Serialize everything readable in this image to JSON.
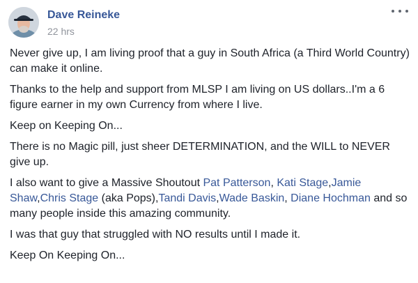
{
  "post": {
    "author": "Dave Reineke",
    "timestamp": "22 hrs",
    "more_icon": "ellipsis-icon",
    "paragraphs": {
      "p1": "Never give up, I am living proof that a guy in South Africa (a Third World Country) can make it online.",
      "p2": "Thanks to the help and support from MLSP I am living on US dollars..I'm a 6 figure earner in my own Currency from where I live.",
      "p3": "Keep on Keeping On...",
      "p4": "There is no Magic pill, just sheer DETERMINATION, and the WILL to NEVER give up.",
      "p5_start": "I also want to give a Massive Shoutout ",
      "p5_comma": ", ",
      "p5_c2": ",",
      "p5_c3": ",",
      "p5_pops": " (aka Pops),",
      "p5_c4": ",",
      "p5_c5": ", ",
      "p5_end": " and so many people inside this amazing community.",
      "p6": "I was that guy that struggled with NO results until I made it.",
      "p7": "Keep On Keeping On..."
    },
    "mentions": {
      "m1": "Pat Patterson",
      "m2": "Kati Stage",
      "m3": "Jamie Shaw",
      "m4": "Chris Stage",
      "m5": "Tandi Davis",
      "m6": "Wade Baskin",
      "m7": "Diane Hochman"
    }
  },
  "colors": {
    "link": "#385898",
    "text": "#1d2129",
    "meta": "#90949c"
  }
}
